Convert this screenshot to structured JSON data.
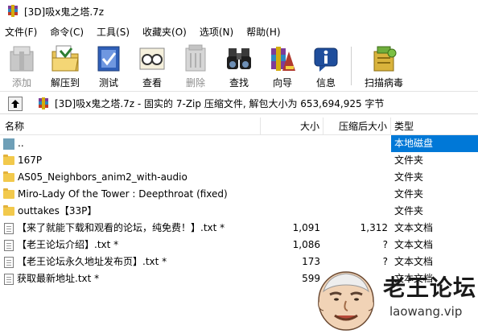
{
  "window": {
    "title": "[3D]吸x鬼之塔.7z"
  },
  "menu": [
    "文件(F)",
    "命令(C)",
    "工具(S)",
    "收藏夹(O)",
    "选项(N)",
    "帮助(H)"
  ],
  "toolbar": {
    "add": "添加",
    "extract": "解压到",
    "test": "测试",
    "view": "查看",
    "delete": "删除",
    "find": "查找",
    "wizard": "向导",
    "info": "信息",
    "scan": "扫描病毒"
  },
  "address": {
    "path": "[3D]吸x鬼之塔.7z - 固实的 7-Zip 压缩文件, 解包大小为 653,694,925 字节"
  },
  "columns": {
    "name": "名称",
    "size": "大小",
    "packed": "压缩后大小",
    "type": "类型"
  },
  "rows": [
    {
      "name": "..",
      "size": "",
      "packed": "",
      "type": "本地磁盘",
      "icon": "parent-folder-icon"
    },
    {
      "name": "167P",
      "size": "",
      "packed": "",
      "type": "文件夹",
      "icon": "folder-icon"
    },
    {
      "name": "AS05_Neighbors_anim2_with-audio",
      "size": "",
      "packed": "",
      "type": "文件夹",
      "icon": "folder-icon"
    },
    {
      "name": "Miro-Lady Of the Tower : Deepthroat (fixed)",
      "size": "",
      "packed": "",
      "type": "文件夹",
      "icon": "folder-icon"
    },
    {
      "name": "outtakes【33P】",
      "size": "",
      "packed": "",
      "type": "文件夹",
      "icon": "folder-icon"
    },
    {
      "name": "【来了就能下载和观看的论坛，纯免费！】.txt *",
      "size": "1,091",
      "packed": "1,312",
      "type": "文本文档",
      "icon": "text-file-icon"
    },
    {
      "name": "【老王论坛介绍】.txt *",
      "size": "1,086",
      "packed": "?",
      "type": "文本文档",
      "icon": "text-file-icon"
    },
    {
      "name": "【老王论坛永久地址发布页】.txt *",
      "size": "173",
      "packed": "?",
      "type": "文本文档",
      "icon": "text-file-icon"
    },
    {
      "name": "获取最新地址.txt *",
      "size": "599",
      "packed": "",
      "type": "文本文档",
      "icon": "text-file-icon"
    }
  ],
  "watermark": {
    "title": "老王论坛",
    "url": "laowang.vip"
  },
  "colors": {
    "selection": "#0078d7",
    "folder": "#f2c94c"
  }
}
